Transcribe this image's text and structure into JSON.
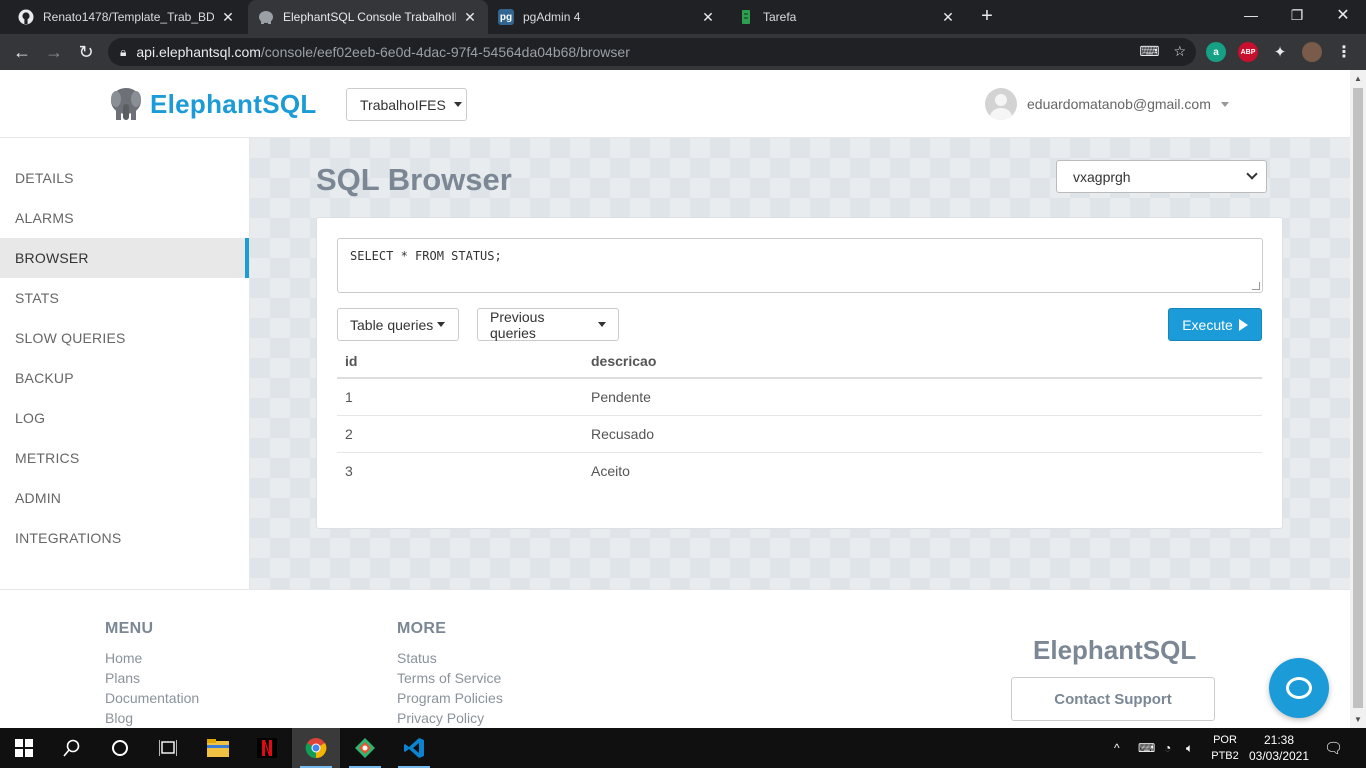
{
  "browser": {
    "tabs": [
      {
        "title": "Renato1478/Template_Trab_BD1_",
        "icon": "github-icon"
      },
      {
        "title": "ElephantSQL Console TrabalhoIFES",
        "icon": "elephantsql-icon"
      },
      {
        "title": "pgAdmin 4",
        "icon": "pgadmin-icon",
        "badge": "pg"
      },
      {
        "title": "Tarefa",
        "icon": "tarefa-icon"
      }
    ],
    "url_host": "api.elephantsql.com",
    "url_path": "/console/eef02eeb-6e0d-4dac-97f4-54564da04b68/browser",
    "abp_badge": "ABP",
    "ext_a_badge": "a"
  },
  "header": {
    "brand": "ElephantSQL",
    "instance": "TrabalhoIFES",
    "user_email": "eduardomatanob@gmail.com"
  },
  "sidebar": {
    "items": [
      {
        "label": "DETAILS"
      },
      {
        "label": "ALARMS"
      },
      {
        "label": "BROWSER",
        "active": true
      },
      {
        "label": "STATS"
      },
      {
        "label": "SLOW QUERIES"
      },
      {
        "label": "BACKUP"
      },
      {
        "label": "LOG"
      },
      {
        "label": "METRICS"
      },
      {
        "label": "ADMIN"
      },
      {
        "label": "INTEGRATIONS"
      }
    ]
  },
  "main": {
    "title": "SQL Browser",
    "database": "vxagprgh",
    "query": "SELECT * FROM STATUS;",
    "table_queries_label": "Table queries",
    "previous_queries_label": "Previous queries",
    "execute_label": "Execute",
    "results": {
      "columns": [
        "id",
        "descricao"
      ],
      "rows": [
        [
          "1",
          "Pendente"
        ],
        [
          "2",
          "Recusado"
        ],
        [
          "3",
          "Aceito"
        ]
      ]
    }
  },
  "footer": {
    "menu_heading": "MENU",
    "menu_links": [
      "Home",
      "Plans",
      "Documentation",
      "Blog"
    ],
    "more_heading": "MORE",
    "more_links": [
      "Status",
      "Terms of Service",
      "Program Policies",
      "Privacy Policy"
    ],
    "brand": "ElephantSQL",
    "contact_label": "Contact Support"
  },
  "taskbar": {
    "language": "POR",
    "layout": "PTB2",
    "time": "21:38",
    "date": "03/03/2021"
  },
  "colors": {
    "accent": "#1b9bd7",
    "chrome_dark": "#202124",
    "chrome_toolbar": "#35363a"
  }
}
